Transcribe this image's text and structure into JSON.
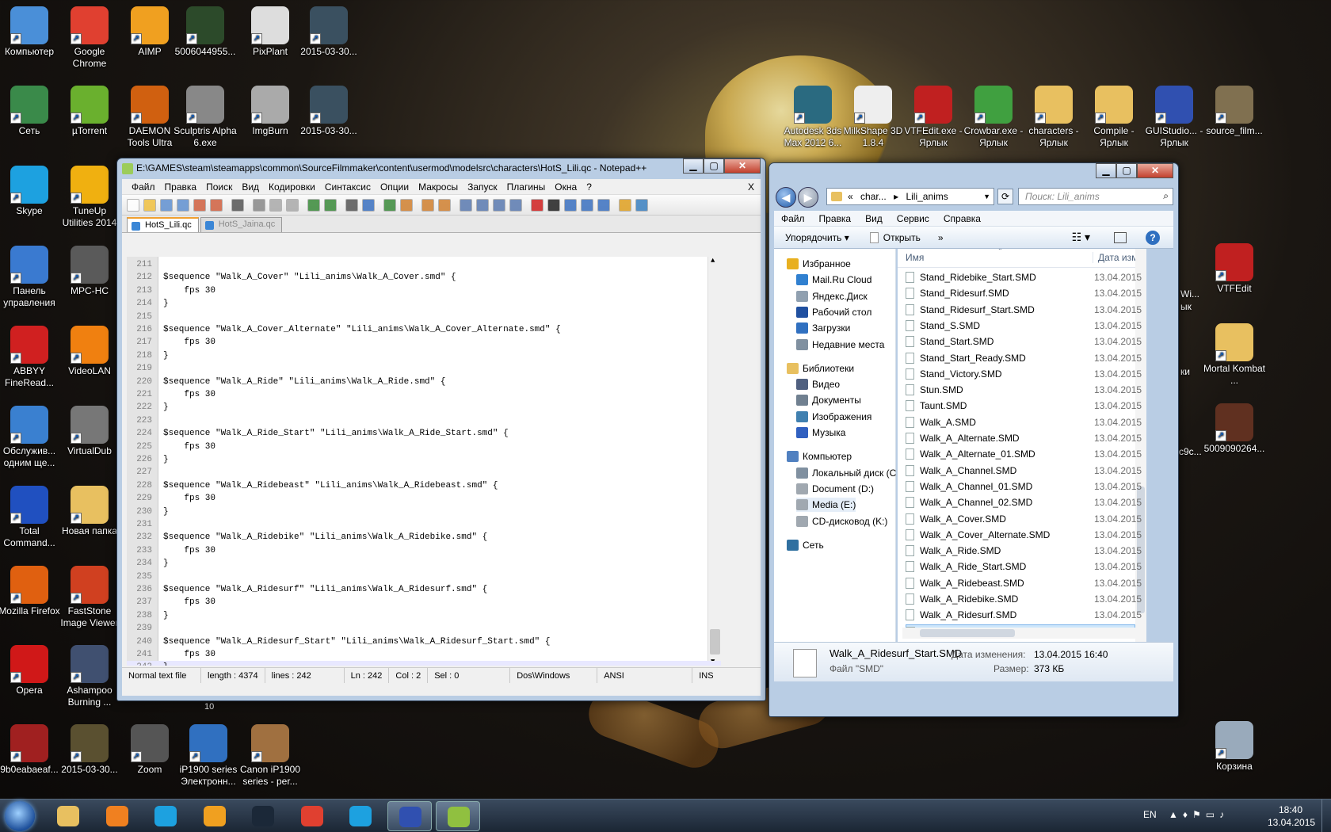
{
  "desktop": {
    "icons_left": [
      {
        "label": "Компьютер",
        "icon": "computer-icon",
        "color": "#4a8fd8"
      },
      {
        "label": "Google Chrome",
        "icon": "chrome-icon",
        "color": "#e04030"
      },
      {
        "label": "AIMP",
        "icon": "aimp-icon",
        "color": "#f0a020"
      },
      {
        "label": "5006044955...",
        "icon": "image-icon",
        "color": "#2c4a2a"
      },
      {
        "label": "PixPlant",
        "icon": "pixplant-icon",
        "color": "#ddd"
      },
      {
        "label": "2015-03-30...",
        "icon": "image-icon",
        "color": "#3a5060"
      },
      {
        "label": "Сеть",
        "icon": "network-icon",
        "color": "#3a8a4a"
      },
      {
        "label": "µTorrent",
        "icon": "utorrent-icon",
        "color": "#6ab02e"
      },
      {
        "label": "DAEMON Tools Ultra",
        "icon": "daemon-icon",
        "color": "#d06010"
      },
      {
        "label": "Sculptris Alpha 6.exe",
        "icon": "sculptris-icon",
        "color": "#888"
      },
      {
        "label": "ImgBurn",
        "icon": "imgburn-icon",
        "color": "#aaa"
      },
      {
        "label": "2015-03-30...",
        "icon": "image-icon",
        "color": "#3a5060"
      },
      {
        "label": "Skype",
        "icon": "skype-icon",
        "color": "#1da1e0"
      },
      {
        "label": "TuneUp Utilities 2014",
        "icon": "tuneup-icon",
        "color": "#f0b010"
      },
      {
        "label": "Панель управления",
        "icon": "control-panel-icon",
        "color": "#3a7ad0"
      },
      {
        "label": "MPC-HC",
        "icon": "mpc-icon",
        "color": "#5a5a5a"
      },
      {
        "label": "ABBYY FineRead...",
        "icon": "abbyy-icon",
        "color": "#d02020"
      },
      {
        "label": "VideoLAN",
        "icon": "vlc-icon",
        "color": "#f08010"
      },
      {
        "label": "Обслужив... одним ще...",
        "icon": "service-icon",
        "color": "#3a80d0"
      },
      {
        "label": "VirtualDub",
        "icon": "virtualdub-icon",
        "color": "#777"
      },
      {
        "label": "Total Command...",
        "icon": "totalcmd-icon",
        "color": "#2050c0"
      },
      {
        "label": "Новая папка",
        "icon": "folder-icon",
        "color": "#e8c060"
      },
      {
        "label": "Mozilla Firefox",
        "icon": "firefox-icon",
        "color": "#e06010"
      },
      {
        "label": "FastStone Image Viewer",
        "icon": "faststone-icon",
        "color": "#d04020"
      },
      {
        "label": "Opera",
        "icon": "opera-icon",
        "color": "#d01818"
      },
      {
        "label": "Ashampoo Burning ...",
        "icon": "ashampoo-icon",
        "color": "#405070"
      },
      {
        "label": "9b0eabaeaf...",
        "icon": "image-icon",
        "color": "#a02020"
      },
      {
        "label": "2015-03-30...",
        "icon": "image-icon",
        "color": "#5a5030"
      },
      {
        "label": "Zoom",
        "icon": "zoom-icon",
        "color": "#555"
      },
      {
        "label": "iP1900 series Электронн...",
        "icon": "printer-manual-icon",
        "color": "#3070c0"
      },
      {
        "label": "Canon iP1900 series - per...",
        "icon": "printer-icon",
        "color": "#a07040"
      }
    ],
    "icons_right": [
      {
        "label": "Autodesk 3ds Max 2012 6...",
        "icon": "3dsmax-icon",
        "color": "#2a6a80"
      },
      {
        "label": "MilkShape 3D 1.8.4",
        "icon": "milkshape-icon",
        "color": "#eee"
      },
      {
        "label": "VTFEdit.exe - Ярлык",
        "icon": "vtfedit-icon",
        "color": "#c02020"
      },
      {
        "label": "Crowbar.exe - Ярлык",
        "icon": "crowbar-icon",
        "color": "#40a040"
      },
      {
        "label": "characters - Ярлык",
        "icon": "folder-icon",
        "color": "#e8c060"
      },
      {
        "label": "Compile - Ярлык",
        "icon": "folder-icon",
        "color": "#e8c060"
      },
      {
        "label": "GUIStudio... - Ярлык",
        "icon": "guistudio-icon",
        "color": "#3050b0"
      },
      {
        "label": "source_film...",
        "icon": "sfm-icon",
        "color": "#807050"
      },
      {
        "label": "VTFEdit",
        "icon": "vtfedit-icon",
        "color": "#c02020"
      },
      {
        "label": "Mortal Kombat ...",
        "icon": "folder-icon",
        "color": "#e8c060"
      },
      {
        "label": "5009090264...",
        "icon": "image-icon",
        "color": "#603020"
      },
      {
        "label": "Корзина",
        "icon": "recycle-bin-icon",
        "color": "#9ab"
      }
    ],
    "partial_labels": [
      "Wi...",
      "ык",
      "ки",
      "c9c..."
    ]
  },
  "notepad": {
    "title": "E:\\GAMES\\steam\\steamapps\\common\\SourceFilmmaker\\content\\usermod\\modelsrc\\characters\\HotS_Lili.qc - Notepad++",
    "menu": [
      "Файл",
      "Правка",
      "Поиск",
      "Вид",
      "Кодировки",
      "Синтаксис",
      "Опции",
      "Макросы",
      "Запуск",
      "Плагины",
      "Окна",
      "?"
    ],
    "menu_close": "X",
    "tabs": [
      {
        "label": "HotS_Lili.qc",
        "active": true
      },
      {
        "label": "HotS_Jaina.qc",
        "active": false
      }
    ],
    "lines": [
      {
        "n": "211",
        "t": ""
      },
      {
        "n": "212",
        "t": "$sequence \"Walk_A_Cover\" \"Lili_anims\\Walk_A_Cover.smd\" {"
      },
      {
        "n": "213",
        "t": "    fps 30"
      },
      {
        "n": "214",
        "t": "}"
      },
      {
        "n": "215",
        "t": ""
      },
      {
        "n": "216",
        "t": "$sequence \"Walk_A_Cover_Alternate\" \"Lili_anims\\Walk_A_Cover_Alternate.smd\" {"
      },
      {
        "n": "217",
        "t": "    fps 30"
      },
      {
        "n": "218",
        "t": "}"
      },
      {
        "n": "219",
        "t": ""
      },
      {
        "n": "220",
        "t": "$sequence \"Walk_A_Ride\" \"Lili_anims\\Walk_A_Ride.smd\" {"
      },
      {
        "n": "221",
        "t": "    fps 30"
      },
      {
        "n": "222",
        "t": "}"
      },
      {
        "n": "223",
        "t": ""
      },
      {
        "n": "224",
        "t": "$sequence \"Walk_A_Ride_Start\" \"Lili_anims\\Walk_A_Ride_Start.smd\" {"
      },
      {
        "n": "225",
        "t": "    fps 30"
      },
      {
        "n": "226",
        "t": "}"
      },
      {
        "n": "227",
        "t": ""
      },
      {
        "n": "228",
        "t": "$sequence \"Walk_A_Ridebeast\" \"Lili_anims\\Walk_A_Ridebeast.smd\" {"
      },
      {
        "n": "229",
        "t": "    fps 30"
      },
      {
        "n": "230",
        "t": "}"
      },
      {
        "n": "231",
        "t": ""
      },
      {
        "n": "232",
        "t": "$sequence \"Walk_A_Ridebike\" \"Lili_anims\\Walk_A_Ridebike.smd\" {"
      },
      {
        "n": "233",
        "t": "    fps 30"
      },
      {
        "n": "234",
        "t": "}"
      },
      {
        "n": "235",
        "t": ""
      },
      {
        "n": "236",
        "t": "$sequence \"Walk_A_Ridesurf\" \"Lili_anims\\Walk_A_Ridesurf.smd\" {"
      },
      {
        "n": "237",
        "t": "    fps 30"
      },
      {
        "n": "238",
        "t": "}"
      },
      {
        "n": "239",
        "t": ""
      },
      {
        "n": "240",
        "t": "$sequence \"Walk_A_Ridesurf_Start\" \"Lili_anims\\Walk_A_Ridesurf_Start.smd\" {"
      },
      {
        "n": "241",
        "t": "    fps 30"
      },
      {
        "n": "242",
        "t": "}"
      }
    ],
    "status": {
      "type": "Normal text file",
      "length": "length : 4374",
      "lines": "lines : 242",
      "ln": "Ln : 242",
      "col": "Col : 2",
      "sel": "Sel : 0",
      "eol": "Dos\\Windows",
      "enc": "ANSI",
      "mode": "INS"
    },
    "under_status": "10"
  },
  "explorer": {
    "breadcrumb": [
      "«",
      "char...",
      "▸",
      "Lili_anims"
    ],
    "search_placeholder": "Поиск: Lili_anims",
    "menu": [
      "Файл",
      "Правка",
      "Вид",
      "Сервис",
      "Справка"
    ],
    "commands": {
      "organize": "Упорядочить ▾",
      "open": "Открыть",
      "more": "»"
    },
    "nav": [
      {
        "label": "Избранное",
        "group": true,
        "color": "#e8b020"
      },
      {
        "label": "Mail.Ru Cloud",
        "group": false,
        "color": "#3080d0"
      },
      {
        "label": "Яндекс.Диск",
        "group": false,
        "color": "#90a0b0"
      },
      {
        "label": "Рабочий стол",
        "group": false,
        "color": "#2050a0"
      },
      {
        "label": "Загрузки",
        "group": false,
        "color": "#3070c0"
      },
      {
        "label": "Недавние места",
        "group": false,
        "color": "#8090a0"
      },
      {
        "label": "Библиотеки",
        "group": true,
        "color": "#e8c060"
      },
      {
        "label": "Видео",
        "group": false,
        "color": "#506080"
      },
      {
        "label": "Документы",
        "group": false,
        "color": "#708090"
      },
      {
        "label": "Изображения",
        "group": false,
        "color": "#4080b0"
      },
      {
        "label": "Музыка",
        "group": false,
        "color": "#3060c0"
      },
      {
        "label": "Компьютер",
        "group": true,
        "color": "#5080c0"
      },
      {
        "label": "Локальный диск (C",
        "group": false,
        "color": "#8090a0"
      },
      {
        "label": "Document (D:)",
        "group": false,
        "color": "#a0a8b0"
      },
      {
        "label": "Media (E:)",
        "group": false,
        "color": "#a0a8b0",
        "selected": true
      },
      {
        "label": "CD-дисковод (K:)",
        "group": false,
        "color": "#a0a8b0"
      },
      {
        "label": "Сеть",
        "group": true,
        "color": "#3070a0"
      }
    ],
    "columns": {
      "name": "Имя",
      "date": "Дата изм"
    },
    "files": [
      {
        "name": "Stand_Ridebike_Start.SMD",
        "date": "13.04.2015"
      },
      {
        "name": "Stand_Ridesurf.SMD",
        "date": "13.04.2015"
      },
      {
        "name": "Stand_Ridesurf_Start.SMD",
        "date": "13.04.2015"
      },
      {
        "name": "Stand_S.SMD",
        "date": "13.04.2015"
      },
      {
        "name": "Stand_Start.SMD",
        "date": "13.04.2015"
      },
      {
        "name": "Stand_Start_Ready.SMD",
        "date": "13.04.2015"
      },
      {
        "name": "Stand_Victory.SMD",
        "date": "13.04.2015"
      },
      {
        "name": "Stun.SMD",
        "date": "13.04.2015"
      },
      {
        "name": "Taunt.SMD",
        "date": "13.04.2015"
      },
      {
        "name": "Walk_A.SMD",
        "date": "13.04.2015"
      },
      {
        "name": "Walk_A_Alternate.SMD",
        "date": "13.04.2015"
      },
      {
        "name": "Walk_A_Alternate_01.SMD",
        "date": "13.04.2015"
      },
      {
        "name": "Walk_A_Channel.SMD",
        "date": "13.04.2015"
      },
      {
        "name": "Walk_A_Channel_01.SMD",
        "date": "13.04.2015"
      },
      {
        "name": "Walk_A_Channel_02.SMD",
        "date": "13.04.2015"
      },
      {
        "name": "Walk_A_Cover.SMD",
        "date": "13.04.2015"
      },
      {
        "name": "Walk_A_Cover_Alternate.SMD",
        "date": "13.04.2015"
      },
      {
        "name": "Walk_A_Ride.SMD",
        "date": "13.04.2015"
      },
      {
        "name": "Walk_A_Ride_Start.SMD",
        "date": "13.04.2015"
      },
      {
        "name": "Walk_A_Ridebeast.SMD",
        "date": "13.04.2015"
      },
      {
        "name": "Walk_A_Ridebike.SMD",
        "date": "13.04.2015"
      },
      {
        "name": "Walk_A_Ridesurf.SMD",
        "date": "13.04.2015"
      },
      {
        "name": "Walk_A_Ridesurf_Start.SMD",
        "date": "13.04.2015",
        "selected": true
      }
    ],
    "details": {
      "name": "Walk_A_Ridesurf_Start.SMD",
      "type": "Файл \"SMD\"",
      "modified_label": "Дата изменения:",
      "modified": "13.04.2015 16:40",
      "size_label": "Размер:",
      "size": "373 КБ"
    }
  },
  "taskbar": {
    "lang": "EN",
    "time": "18:40",
    "date": "13.04.2015",
    "buttons": [
      {
        "icon": "explorer-icon",
        "color": "#e8c060"
      },
      {
        "icon": "media-player-icon",
        "color": "#f08020"
      },
      {
        "icon": "skype-icon",
        "color": "#1da1e0"
      },
      {
        "icon": "aimp-icon",
        "color": "#f0a020"
      },
      {
        "icon": "steam-icon",
        "color": "#1b2838"
      },
      {
        "icon": "chrome-icon",
        "color": "#e04030"
      },
      {
        "icon": "skype-icon",
        "color": "#1da1e0"
      },
      {
        "icon": "guistudio-icon",
        "color": "#3050b0"
      },
      {
        "icon": "notepadpp-icon",
        "color": "#90c040"
      }
    ]
  }
}
